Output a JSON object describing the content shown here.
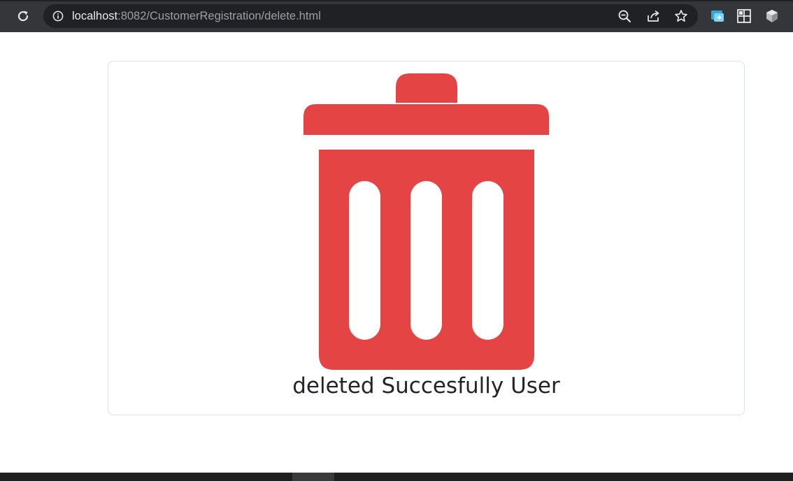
{
  "browser": {
    "url_host": "localhost",
    "url_path": ":8082/CustomerRegistration/delete.html",
    "icons": {
      "reload": "reload-icon",
      "site_info": "info-icon",
      "zoom": "zoom-out-icon",
      "share": "share-icon",
      "bookmark": "star-icon",
      "ext1": "screen-share-extension-icon",
      "ext2": "grid-extension-icon",
      "ext3": "cube-extension-icon"
    }
  },
  "page": {
    "icon": "trash-icon",
    "message": "deleted Succesfully User"
  },
  "colors": {
    "trash": "#e54444",
    "text": "#212529",
    "toolbar": "#35363a",
    "omnibox": "#202124"
  }
}
